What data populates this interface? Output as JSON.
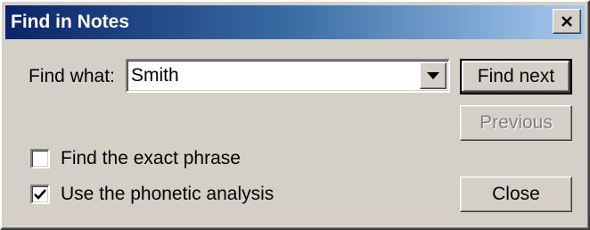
{
  "window": {
    "title": "Find in Notes"
  },
  "find": {
    "label": "Find what:",
    "value": "Smith"
  },
  "buttons": {
    "find_next": "Find next",
    "previous": "Previous",
    "close": "Close"
  },
  "options": {
    "exact_phrase": {
      "label": "Find the exact phrase",
      "checked": false
    },
    "phonetic": {
      "label": "Use the phonetic analysis",
      "checked": true
    }
  },
  "colors": {
    "title_gradient_start": "#0a246a",
    "title_gradient_end": "#a6caf0",
    "face": "#d4d0c8"
  },
  "icons": {
    "close": "close-icon",
    "dropdown": "chevron-down-icon",
    "check": "checkmark-icon"
  }
}
